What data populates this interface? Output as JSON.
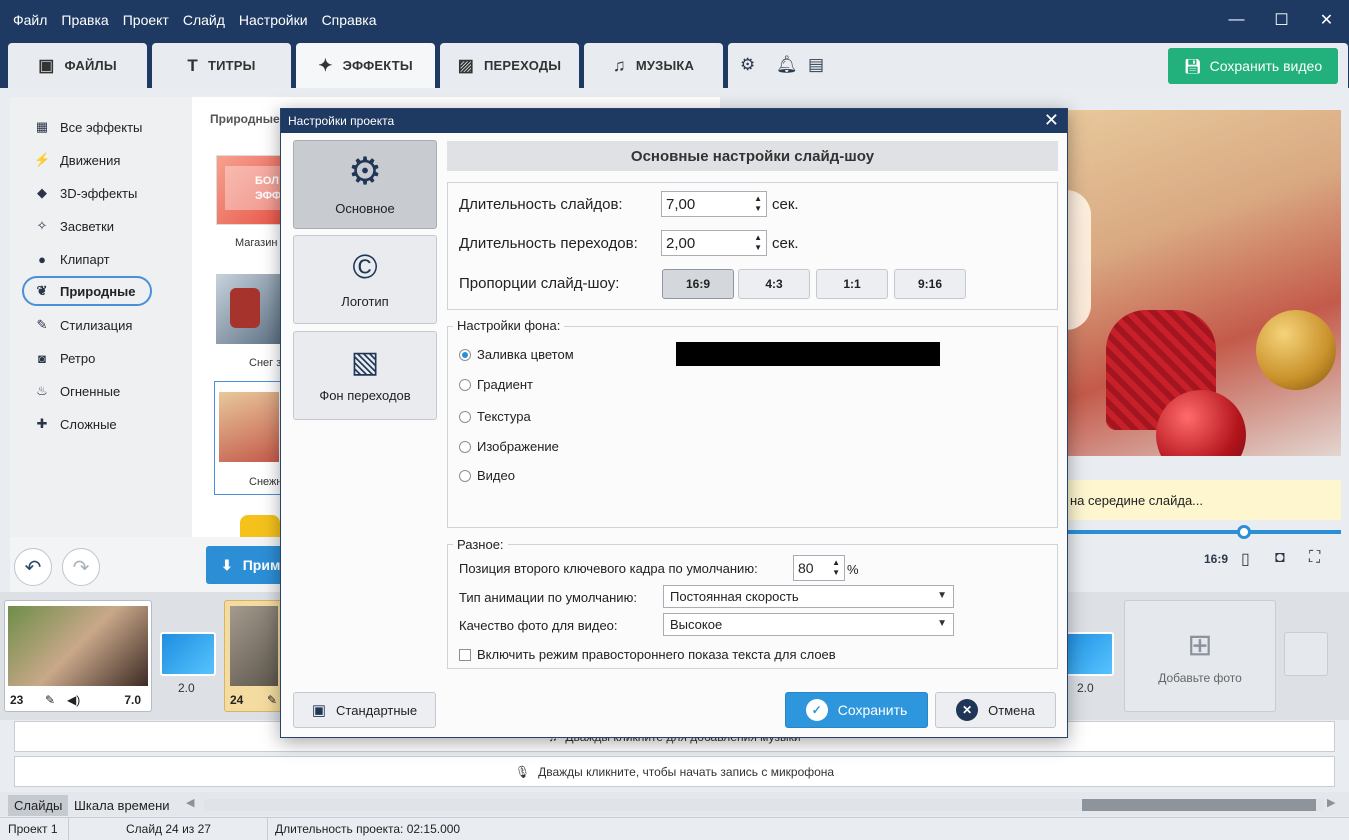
{
  "menu": [
    "Файл",
    "Правка",
    "Проект",
    "Слайд",
    "Настройки",
    "Справка"
  ],
  "window_controls": {
    "minimize": "—",
    "maximize": "☐",
    "close": "✕"
  },
  "tabs": [
    {
      "label": "ФАЙЛЫ",
      "icon": "add-image-icon"
    },
    {
      "label": "ТИТРЫ",
      "icon": "text-t-icon"
    },
    {
      "label": "ЭФФЕКТЫ",
      "icon": "star-effects-icon"
    },
    {
      "label": "ПЕРЕХОДЫ",
      "icon": "transitions-icon"
    },
    {
      "label": "МУЗЫКА",
      "icon": "music-note-icon"
    }
  ],
  "toolbar": {
    "save_video": "Сохранить видео"
  },
  "categories": [
    "Все эффекты",
    "Движения",
    "3D-эффекты",
    "Засветки",
    "Клипарт",
    "Природные",
    "Стилизация",
    "Ретро",
    "Огненные",
    "Сложные"
  ],
  "effects": {
    "header": "Природные (3",
    "thumb1_text": "БОЛ\nЭФФ",
    "captions": [
      "Магазин",
      "Снег з",
      "Снежн"
    ]
  },
  "apply_button": "Прим",
  "preview": {
    "hint": "на середине слайда...",
    "ratio": "16:9"
  },
  "slides": [
    {
      "num": "23",
      "duration": "7.0"
    },
    {
      "num": "24",
      "duration": ""
    }
  ],
  "transitions": [
    "2.0",
    "2.0"
  ],
  "add_photo": "Добавьте фото",
  "audio": {
    "music": "Дважды кликните для добавления музыки",
    "mic": "Дважды кликните, чтобы начать запись с микрофона"
  },
  "bottom_tabs": [
    "Слайды",
    "Шкала времени"
  ],
  "status": {
    "project": "Проект 1",
    "slide": "Слайд 24 из 27",
    "duration": "Длительность проекта: 02:15.000"
  },
  "dialog": {
    "title": "Настройки проекта",
    "nav": [
      {
        "label": "Основное",
        "icon": "gear-icon"
      },
      {
        "label": "Логотип",
        "icon": "copyright-icon"
      },
      {
        "label": "Фон переходов",
        "icon": "layers-hatched-icon"
      }
    ],
    "section_title": "Основные настройки слайд-шоу",
    "slide_duration_label": "Длительность слайдов:",
    "slide_duration_value": "7,00",
    "transition_duration_label": "Длительность переходов:",
    "transition_duration_value": "2,00",
    "sec_unit": "сек.",
    "aspect_label": "Пропорции слайд-шоу:",
    "aspects": [
      "16:9",
      "4:3",
      "1:1",
      "9:16"
    ],
    "aspect_selected": "16:9",
    "bg_group_title": "Настройки фона:",
    "bg_options": [
      "Заливка цветом",
      "Градиент",
      "Текстура",
      "Изображение",
      "Видео"
    ],
    "bg_selected": "Заливка цветом",
    "bg_color": "#000000",
    "misc_group_title": "Разное:",
    "keyframe_label": "Позиция второго ключевого кадра по умолчанию:",
    "keyframe_value": "80",
    "percent": "%",
    "anim_label": "Тип анимации по умолчанию:",
    "anim_value": "Постоянная скорость",
    "quality_label": "Качество фото для видео:",
    "quality_value": "Высокое",
    "rtl_label": "Включить режим правостороннего показа текста для слоев",
    "defaults_button": "Стандартные",
    "save_button": "Сохранить",
    "cancel_button": "Отмена"
  },
  "colors": {
    "titlebar": "#1e3a62",
    "accent": "#2c8fd6",
    "save_green": "#22b07d"
  }
}
